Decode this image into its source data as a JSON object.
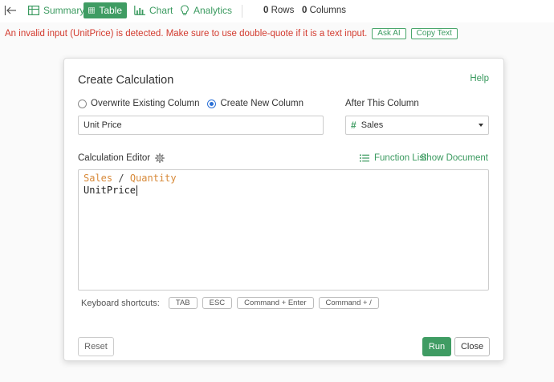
{
  "toolbar": {
    "tabs": [
      {
        "label": "Summary",
        "icon": "summary-grid-icon"
      },
      {
        "label": "Table",
        "icon": "table-icon",
        "active": true
      },
      {
        "label": "Chart",
        "icon": "bar-chart-icon"
      },
      {
        "label": "Analytics",
        "icon": "lightbulb-icon"
      }
    ],
    "rows_count": "0",
    "rows_label": "Rows",
    "columns_count": "0",
    "columns_label": "Columns"
  },
  "error": {
    "message": "An invalid input (UnitPrice) is detected. Make sure to use double-quote if it is a text input.",
    "ask_ai_label": "Ask AI",
    "copy_text_label": "Copy Text"
  },
  "dialog": {
    "title": "Create Calculation",
    "help_label": "Help",
    "radio_overwrite": "Overwrite Existing Column",
    "radio_create": "Create New Column",
    "selected_mode": "create",
    "after_column_label": "After This Column",
    "column_name_value": "Unit Price",
    "after_column_value": "Sales",
    "editor_label": "Calculation Editor",
    "function_list_label": "Function List",
    "show_document_label": "Show Document",
    "code": {
      "line1_col1": "Sales",
      "line1_op": " / ",
      "line1_col2": "Quantity",
      "line2": "UnitPrice"
    },
    "shortcuts_label": "Keyboard shortcuts:",
    "shortcuts": [
      "TAB",
      "ESC",
      "Command + Enter",
      "Command + /"
    ],
    "reset_label": "Reset",
    "run_label": "Run",
    "close_label": "Close"
  },
  "colors": {
    "accent": "#3f9c63",
    "error": "#d33b2f",
    "column_token": "#d88a3a",
    "radio_selected": "#2a6fd6"
  }
}
